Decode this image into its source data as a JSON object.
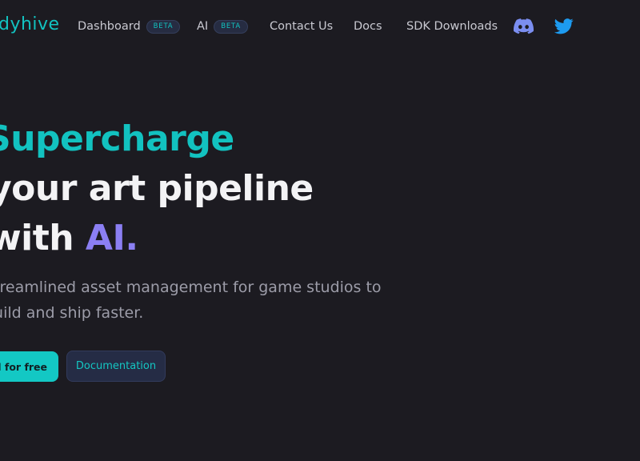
{
  "nav": {
    "logo": "dyhive",
    "items": [
      {
        "label": "Dashboard",
        "badge": "BETA"
      },
      {
        "label": "AI",
        "badge": "BETA"
      },
      {
        "label": "Contact Us"
      },
      {
        "label": "Docs"
      },
      {
        "label": "SDK Downloads"
      }
    ],
    "icons": [
      "discord-icon",
      "twitter-icon"
    ]
  },
  "hero": {
    "line1": "Supercharge",
    "line2": "your art pipeline",
    "line3_prefix": "with ",
    "line3_accent": "AI.",
    "subtitle_line1": "Streamlined asset management for game studios to",
    "subtitle_line2": "build and ship faster.",
    "primary_button": "Get started for free",
    "secondary_button": "Documentation"
  },
  "colors": {
    "background": "#1c1b21",
    "teal": "#12c2c0",
    "purple": "#8b7ff3",
    "discord": "#7b8ef0",
    "twitter": "#1d9bf0"
  }
}
